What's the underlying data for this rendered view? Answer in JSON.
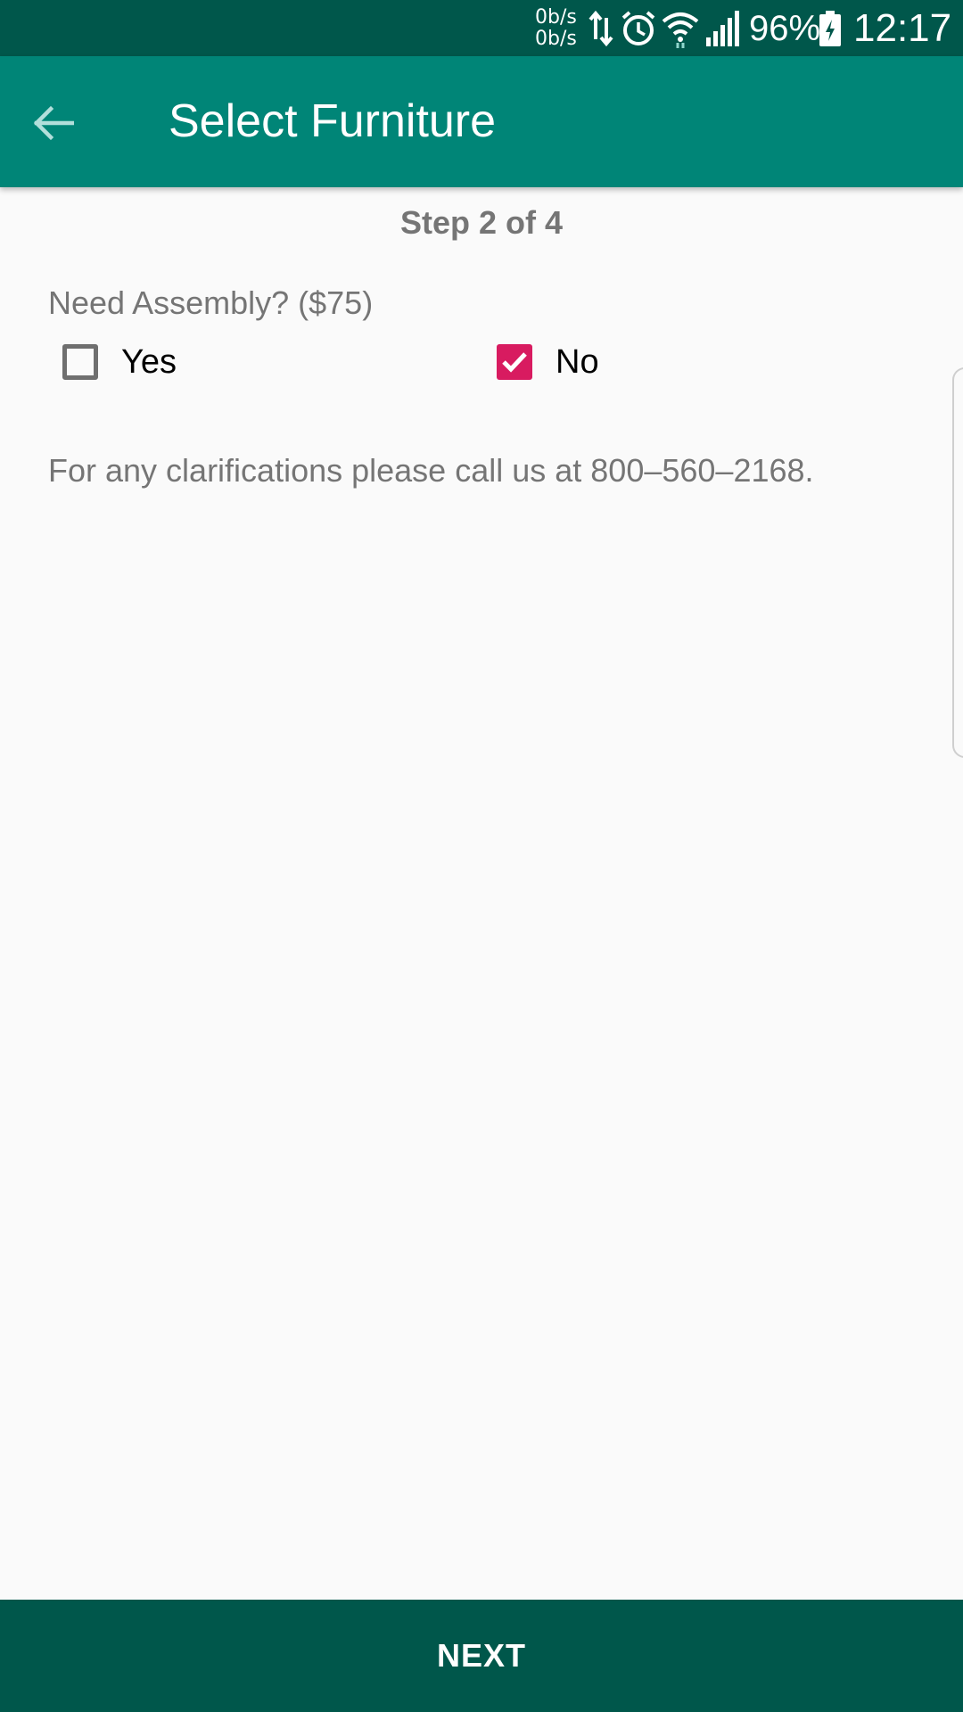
{
  "status_bar": {
    "net_speed_up": "0b/s",
    "net_speed_down": "0b/s",
    "battery_percent": "96%",
    "time": "12:17",
    "icons": [
      "data-transfer-icon",
      "alarm-icon",
      "wifi-icon",
      "signal-icon",
      "battery-charging-icon"
    ]
  },
  "app_bar": {
    "title": "Select Furniture",
    "back_icon": "arrow-back-icon"
  },
  "form": {
    "step": "Step 2 of 4",
    "question": "Need Assembly? ($75)",
    "options": [
      {
        "label": "Yes",
        "checked": false
      },
      {
        "label": "No",
        "checked": true
      }
    ],
    "note": "For any clarifications please call us at 800–560–2168."
  },
  "footer": {
    "next_label": "NEXT"
  },
  "colors": {
    "status_bar": "#00574b",
    "app_bar": "#008577",
    "checkbox_accent": "#d81b60",
    "next_button": "#00574b",
    "secondary_text": "#757575",
    "background": "#fafafa"
  }
}
